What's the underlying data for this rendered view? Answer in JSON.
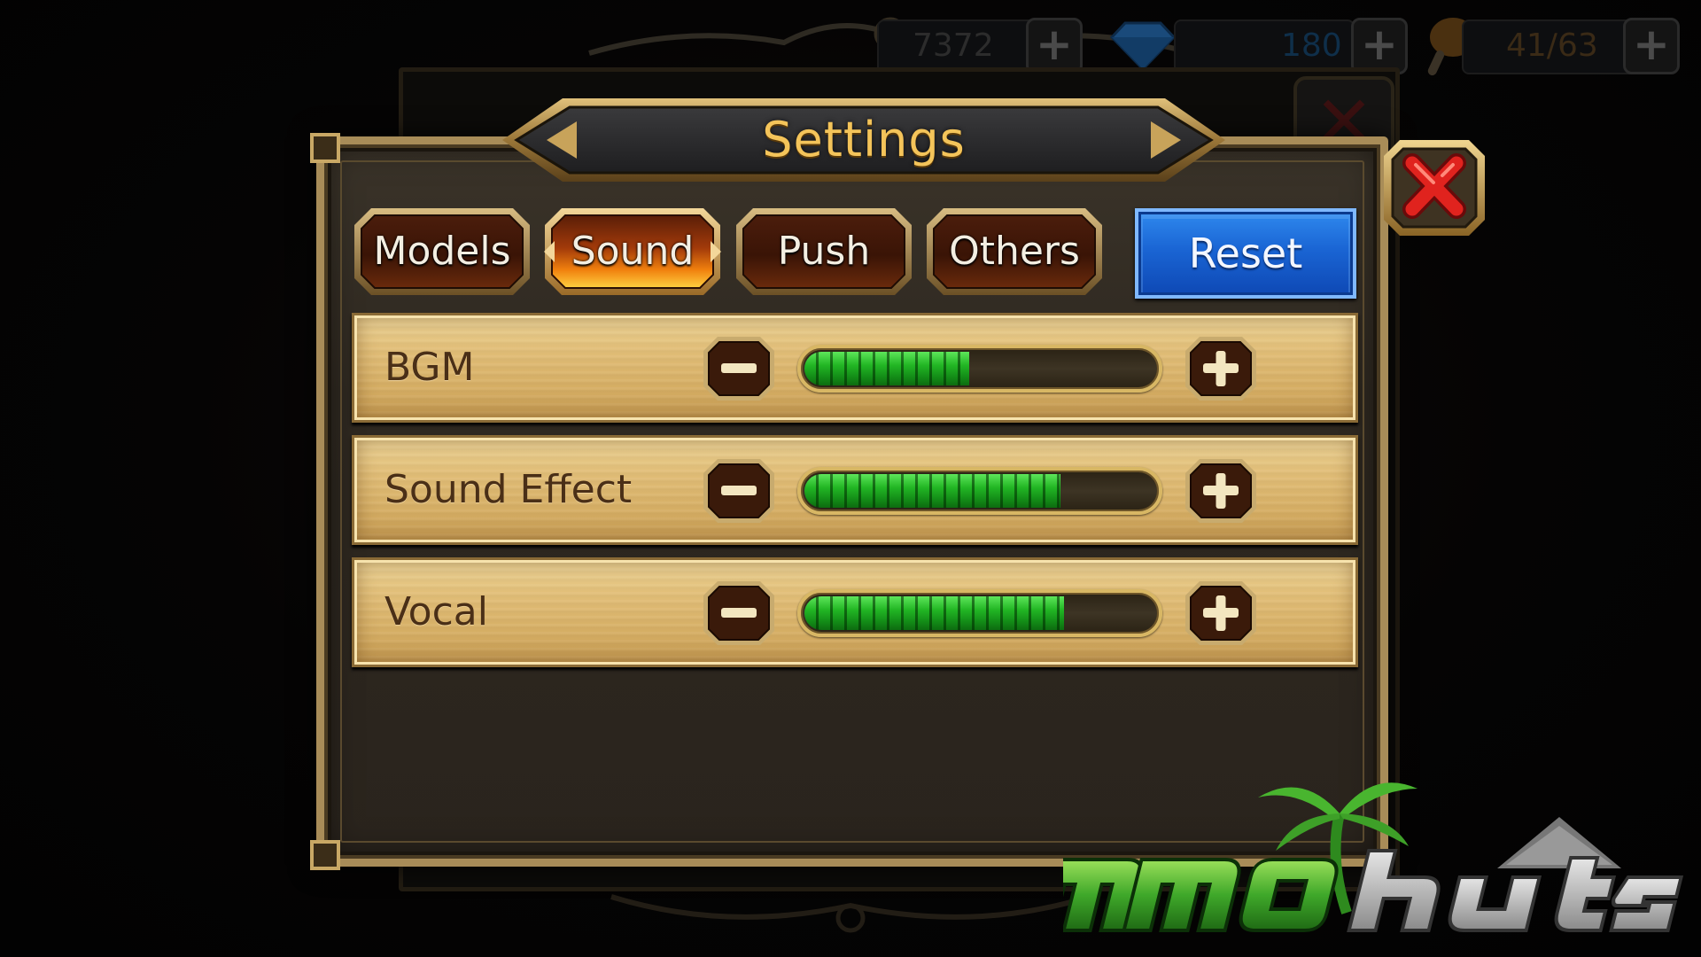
{
  "hud": {
    "gold_value": "7372",
    "gem_value": "180",
    "stamina_value": "41/63"
  },
  "settings": {
    "title": "Settings",
    "tabs": [
      {
        "label": "Models",
        "active": false
      },
      {
        "label": "Sound",
        "active": true
      },
      {
        "label": "Push",
        "active": false
      },
      {
        "label": "Others",
        "active": false
      }
    ],
    "reset_label": "Reset",
    "rows": [
      {
        "label": "BGM",
        "level": 0.47
      },
      {
        "label": "Sound Effect",
        "level": 0.73
      },
      {
        "label": "Vocal",
        "level": 0.74
      }
    ]
  },
  "icons": {
    "close": "close-x-icon",
    "minus": "minus-icon",
    "plus": "plus-icon",
    "gem": "gem-icon",
    "stamina": "meat-icon"
  },
  "colors": {
    "title": "#f4c45a",
    "reset_button": "#1a65d4",
    "bar_fill": "#22b624",
    "row_background": "#e3c07a",
    "close_x": "#e0231e"
  },
  "watermark": {
    "text": "mmohuts"
  }
}
